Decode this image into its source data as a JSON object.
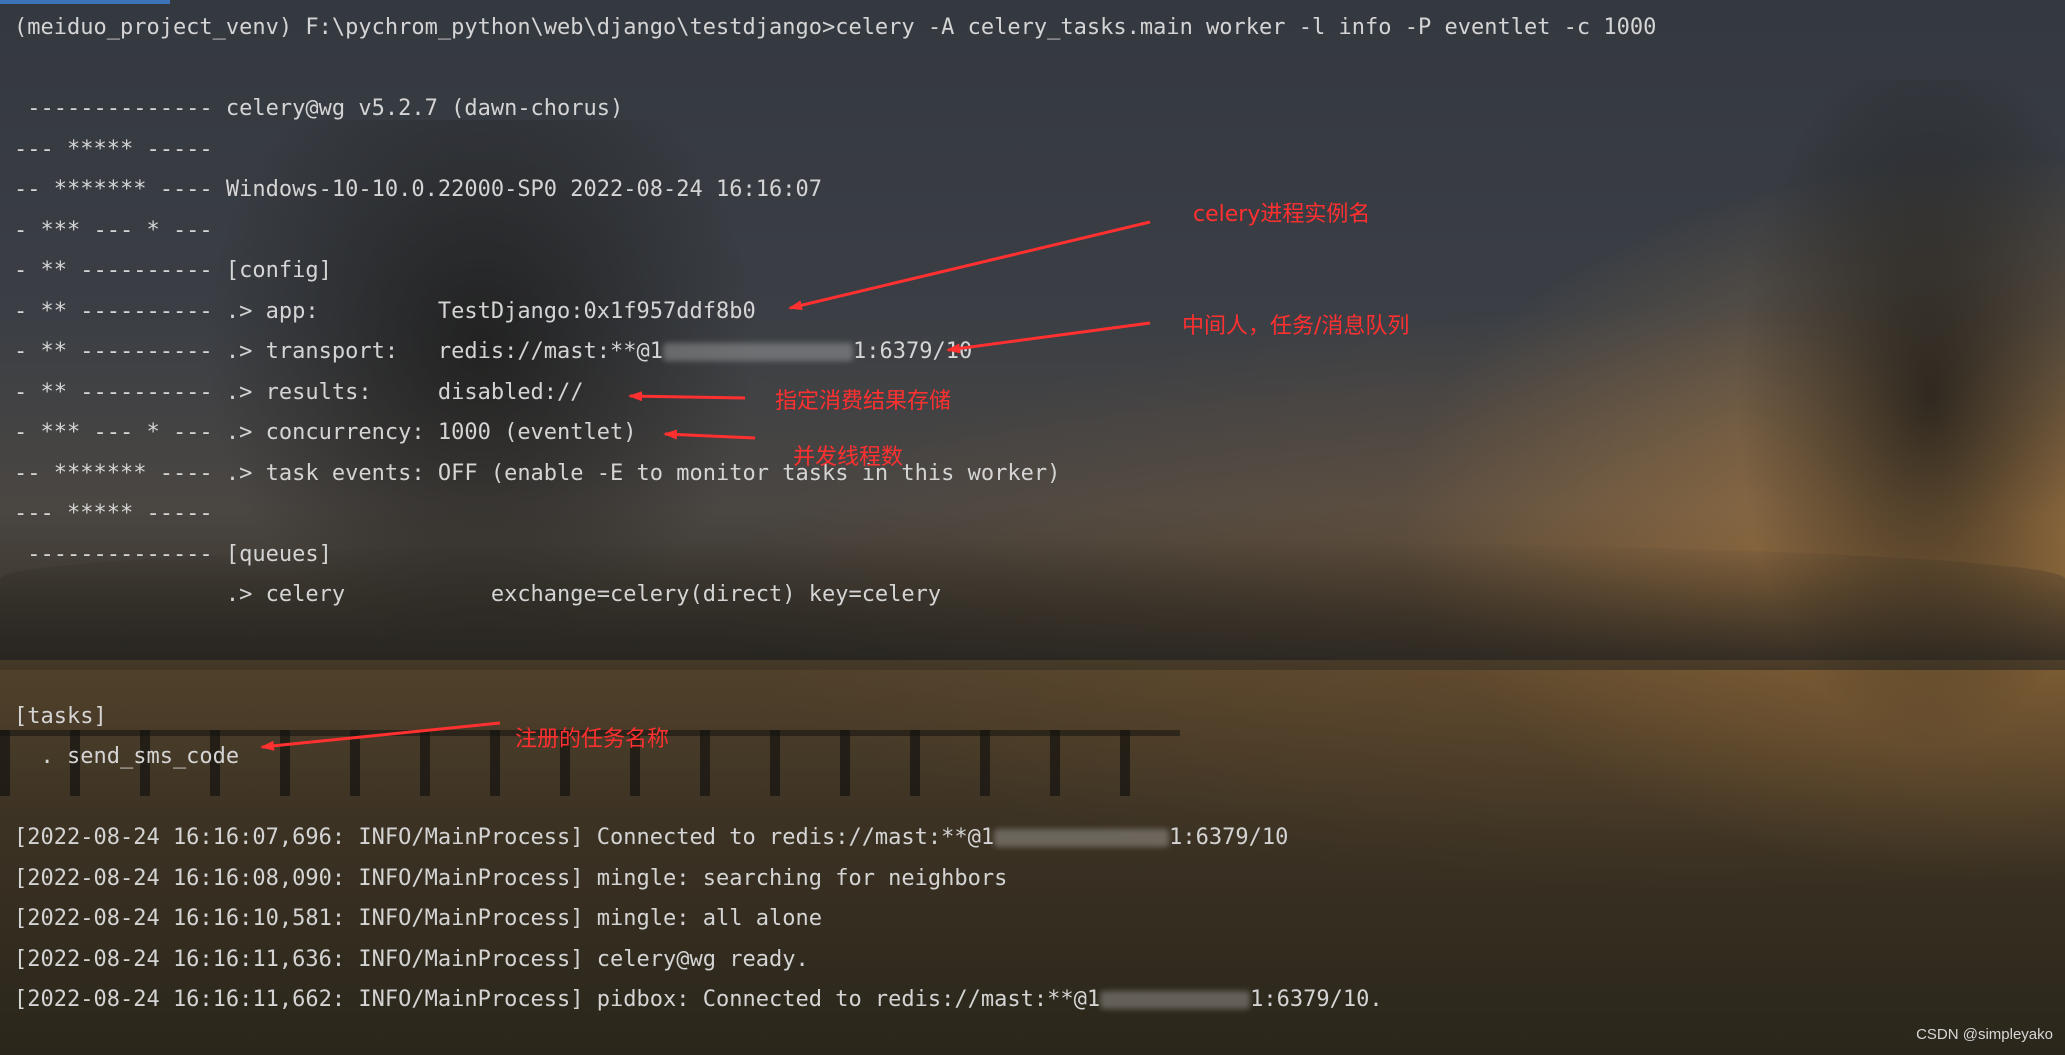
{
  "terminal": {
    "command_line": "(meiduo_project_venv) F:\\pychrom_python\\web\\django\\testdjango>celery -A celery_tasks.main worker -l info -P eventlet -c 1000",
    "banner": [
      " -------------- celery@wg v5.2.7 (dawn-chorus)",
      "--- ***** -----",
      "-- ******* ---- Windows-10-10.0.22000-SP0 2022-08-24 16:16:07",
      "- *** --- * ---",
      "- ** ---------- [config]",
      "- ** ---------- .> app:         TestDjango:0x1f957ddf8b0",
      "- ** ---------- .> transport:   redis://mast:**@1",
      "- ** ---------- .> results:     disabled://",
      "- *** --- * --- .> concurrency: 1000 (eventlet)",
      "-- ******* ---- .> task events: OFF (enable -E to monitor tasks in this worker)",
      "--- ***** -----",
      " -------------- [queues]",
      "                .> celery           exchange=celery(direct) key=celery"
    ],
    "transport_suffix": "1:6379/10",
    "tasks_header": "[tasks]",
    "task_item": "  . send_sms_code",
    "logs": [
      {
        "prefix": "[2022-08-24 16:16:07,696: INFO/MainProcess] Connected to redis://mast:**@1",
        "suffix": "1:6379/10"
      },
      {
        "prefix": "[2022-08-24 16:16:08,090: INFO/MainProcess] mingle: searching for neighbors",
        "suffix": ""
      },
      {
        "prefix": "[2022-08-24 16:16:10,581: INFO/MainProcess] mingle: all alone",
        "suffix": ""
      },
      {
        "prefix": "[2022-08-24 16:16:11,636: INFO/MainProcess] celery@wg ready.",
        "suffix": ""
      },
      {
        "prefix": "[2022-08-24 16:16:11,662: INFO/MainProcess] pidbox: Connected to redis://mast:**@1",
        "suffix": "1:6379/10."
      }
    ]
  },
  "annotations": {
    "instance_name": "celery进程实例名",
    "broker": "中间人，任务/消息队列",
    "results": "指定消费结果存储",
    "concurrency": "并发线程数",
    "tasks": "注册的任务名称"
  },
  "watermark": "CSDN @simpleyako",
  "colors": {
    "annotation": "#ff3030",
    "terminal_text": "#d4d4d4"
  }
}
